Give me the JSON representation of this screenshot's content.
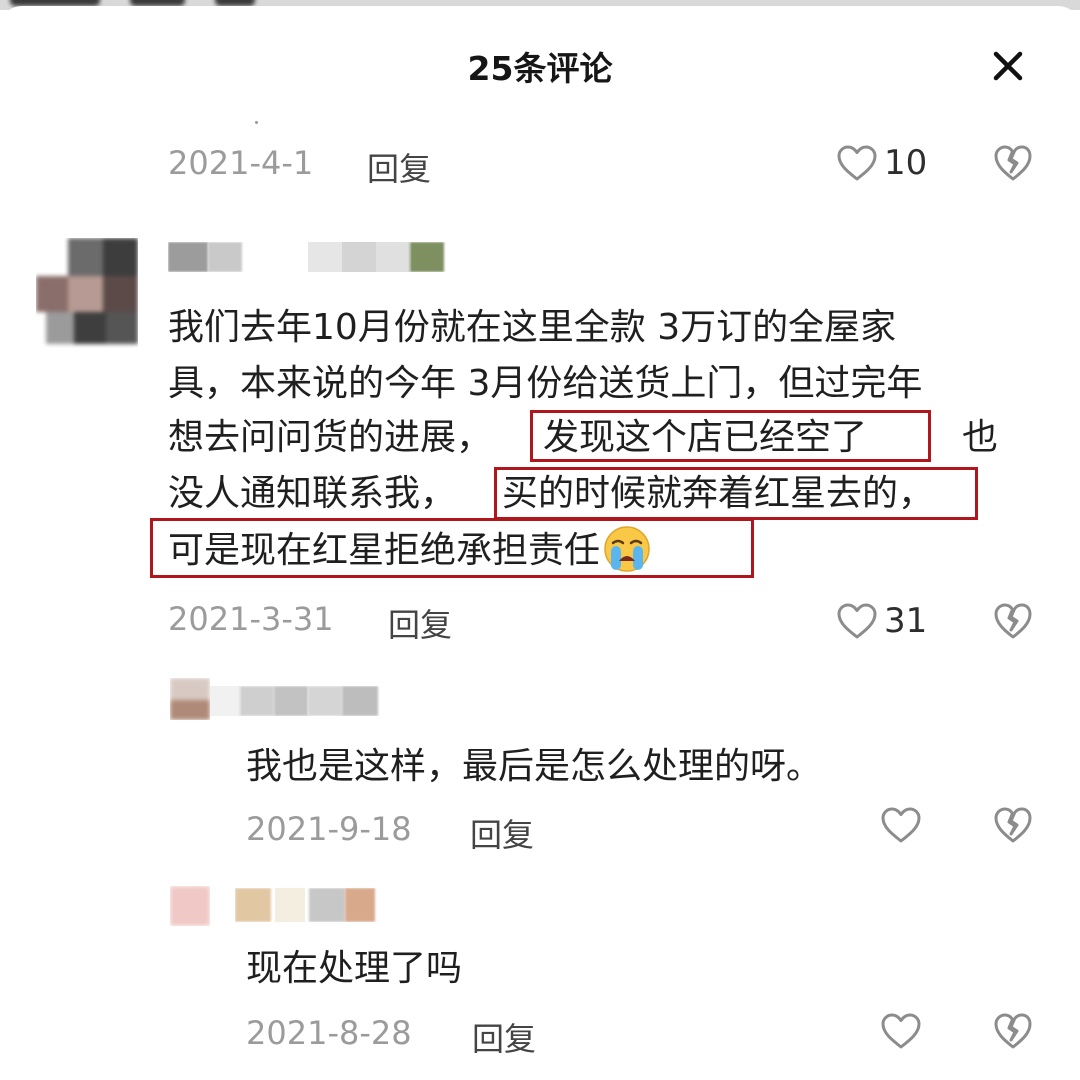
{
  "header": {
    "title": "25条评论"
  },
  "top_comment_footer": {
    "date": "2021-4-1",
    "reply_label": "回复",
    "like_count": "10"
  },
  "main_comment": {
    "lines": [
      "我们去年10月份就在这里全款 3万订的全屋家",
      "具，本来说的今年 3月份给送货上门，但过完年",
      "想去问问货的进展，",
      "发现这个店已经空了",
      "也",
      "没人通知联系我，",
      "买的时候就奔着红星去的，",
      "可是现在红星拒绝承担责任"
    ],
    "date": "2021-3-31",
    "reply_label": "回复",
    "like_count": "31",
    "emoji": "loudly-crying-face"
  },
  "replies": [
    {
      "text": "我也是这样，最后是怎么处理的呀。",
      "date": "2021-9-18",
      "reply_label": "回复"
    },
    {
      "text": "现在处理了吗",
      "date": "2021-8-28",
      "reply_label": "回复"
    }
  ],
  "colors": {
    "highlight_border": "#b0171c",
    "muted_text": "#9b9b9b",
    "icon_gray": "#8c8c8c"
  },
  "icons": [
    "close-icon",
    "heart-outline-icon",
    "broken-heart-icon"
  ]
}
